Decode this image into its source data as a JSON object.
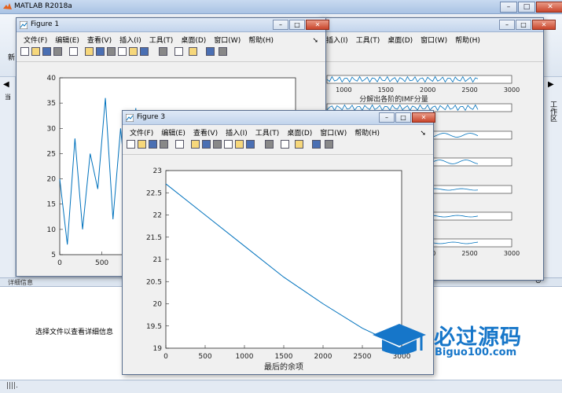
{
  "matlab": {
    "title": "MATLAB R2018a",
    "detail_header": "详细信息",
    "detail_message": "选择文件以查看详细信息",
    "right_tab": "工作区",
    "status_text": "||||.",
    "left_stub_1": "新",
    "left_stub_2": "当"
  },
  "menu": [
    "文件(F)",
    "编辑(E)",
    "查看(V)",
    "插入(I)",
    "工具(T)",
    "桌面(D)",
    "窗口(W)",
    "帮助(H)"
  ],
  "figure1": {
    "title": "Figure 1"
  },
  "figure2": {
    "title": "",
    "menu_visible": [
      "插入(I)",
      "工具(T)",
      "桌面(D)",
      "窗口(W)",
      "帮助(H)"
    ]
  },
  "figure3": {
    "title": "Figure 3"
  },
  "watermark": {
    "main": "必过源码",
    "sub": "Biguo100.com"
  },
  "colors": {
    "line": "#0072bd",
    "watermark": "#1676c9"
  },
  "chart_data": [
    {
      "type": "line",
      "title": "",
      "xlabel": "",
      "ylabel": "",
      "ylim": [
        5,
        40
      ],
      "yticks": [
        5,
        10,
        15,
        20,
        25,
        30,
        35,
        40
      ],
      "xticks_visible": [
        0,
        500
      ],
      "series": [
        {
          "values": [
            20,
            7,
            28,
            10,
            25,
            18,
            36,
            12,
            30,
            15,
            34,
            8,
            28,
            19,
            32,
            11,
            29,
            16,
            33,
            9,
            27,
            18,
            31,
            12,
            26,
            20,
            30,
            14,
            33,
            10,
            29,
            17
          ]
        }
      ]
    },
    {
      "type": "line",
      "title": "",
      "xlabel": "分解出各阶的IMF分量",
      "xticks": [
        1000,
        1500,
        2000,
        2500,
        3000
      ]
    },
    {
      "type": "line",
      "title": "",
      "xlabel": "最后的余项",
      "ylabel": "",
      "xlim": [
        0,
        3000
      ],
      "ylim": [
        19,
        23
      ],
      "xticks": [
        0,
        500,
        1000,
        1500,
        2000,
        2500,
        3000
      ],
      "yticks": [
        19,
        19.5,
        20,
        20.5,
        21,
        21.5,
        22,
        22.5,
        23
      ],
      "series": [
        {
          "x": [
            0,
            500,
            1000,
            1500,
            2000,
            2500,
            2800
          ],
          "y": [
            22.7,
            22.0,
            21.3,
            20.6,
            20.0,
            19.45,
            19.2
          ]
        }
      ]
    }
  ]
}
